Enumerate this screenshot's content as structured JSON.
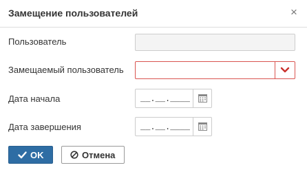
{
  "dialog": {
    "title": "Замещение пользователей",
    "close_glyph": "×"
  },
  "form": {
    "user_label": "Пользователь",
    "user_value": "",
    "replaced_label": "Замещаемый пользователь",
    "replaced_value": "",
    "start_label": "Дата начала",
    "start_mask": "__.__.____",
    "end_label": "Дата завершения",
    "end_mask": "__.__.____"
  },
  "buttons": {
    "ok_label": "OK",
    "cancel_label": "Отмена"
  },
  "icons": {
    "ok": "check-icon",
    "cancel": "ban-icon",
    "dropdown": "chevron-down-icon",
    "calendar": "calendar-icon",
    "close": "close-icon"
  },
  "colors": {
    "primary": "#2e6da4",
    "error": "#d9534f",
    "disabled_bg": "#f4f4f4",
    "border": "#cccccc"
  }
}
